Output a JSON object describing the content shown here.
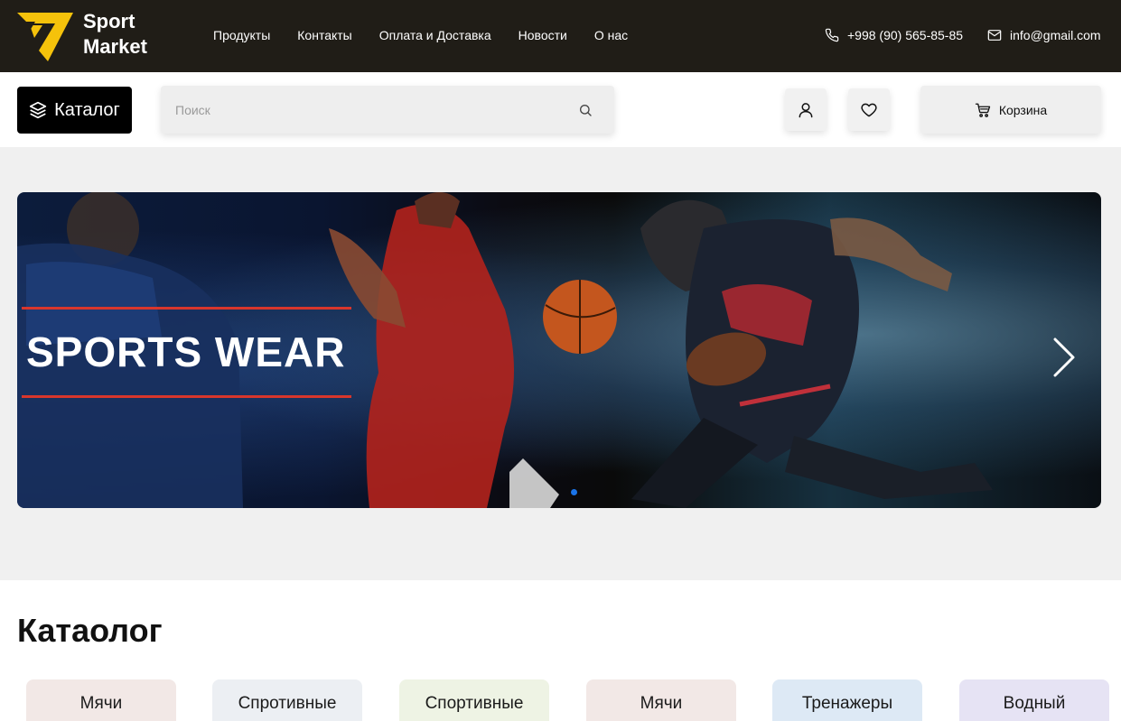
{
  "header": {
    "logo_text_1": "Sport",
    "logo_text_2": "Market",
    "nav": [
      "Продукты",
      "Контакты",
      "Оплата и Доставка",
      "Новости",
      "О нас"
    ],
    "phone": "+998 (90) 565-85-85",
    "email": "info@gmail.com"
  },
  "toolbar": {
    "catalog_label": "Каталог",
    "search_placeholder": "Поиск",
    "cart_label": "Корзина"
  },
  "banner": {
    "title": "SPORTS WEAR"
  },
  "catalog": {
    "title": "Катаолог",
    "items": [
      {
        "label": "Мячи",
        "color": "#f2e8e6"
      },
      {
        "label": "Спротивные",
        "color": "#eceff3"
      },
      {
        "label": "Спортивные",
        "color": "#eef3e4"
      },
      {
        "label": "Мячи",
        "color": "#f2e8e6"
      },
      {
        "label": "Тренажеры",
        "color": "#dde9f5"
      },
      {
        "label": "Водный",
        "color": "#e6e3f4"
      }
    ]
  },
  "colors": {
    "topbar": "#201d17",
    "logo_yellow": "#f5c20b",
    "accent_red": "#d8362c",
    "active_dot": "#1a74e8"
  },
  "icons": [
    "logo-icon",
    "phone-icon",
    "mail-icon",
    "layers-icon",
    "search-icon",
    "user-icon",
    "heart-icon",
    "cart-icon",
    "chevron-right-icon"
  ]
}
